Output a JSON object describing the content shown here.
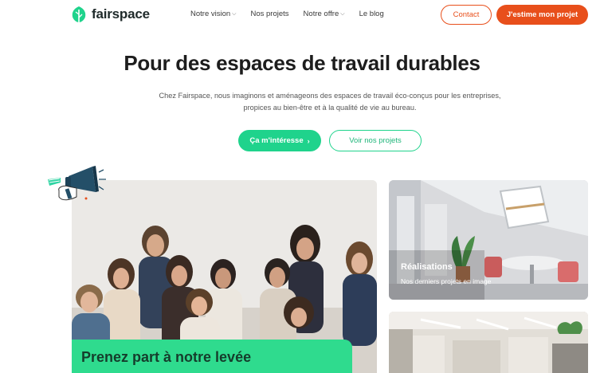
{
  "brand": {
    "name": "fairspace",
    "accent": "#1fd38c",
    "cta_color": "#e84f1b"
  },
  "nav": {
    "items": [
      {
        "label": "Notre vision",
        "dropdown": true
      },
      {
        "label": "Nos projets",
        "dropdown": false
      },
      {
        "label": "Notre offre",
        "dropdown": true
      },
      {
        "label": "Le blog",
        "dropdown": false
      }
    ],
    "contact_label": "Contact",
    "estimate_label": "J'estime mon projet"
  },
  "hero": {
    "title_main": "Pour des espaces de travail ",
    "title_highlight": "durables",
    "subtitle_line1": "Chez Fairspace, nous imaginons et aménageons des espaces de travail éco-conçus pour les entreprises,",
    "subtitle_line2": "propices au bien-être et à la qualité de vie au bureau.",
    "primary_cta": "Ça m'intéresse",
    "secondary_cta": "Voir nos projets"
  },
  "cards": {
    "main": {
      "title": "Prenez part à notre levée"
    },
    "realisations": {
      "title": "Réalisations",
      "subtitle": "Nos derniers projets en image"
    }
  },
  "icons": {
    "logo": "leaf-logo-icon",
    "chevron": "chevron-down-icon",
    "arrow": "chevron-right-icon",
    "megaphone": "megaphone-icon"
  }
}
